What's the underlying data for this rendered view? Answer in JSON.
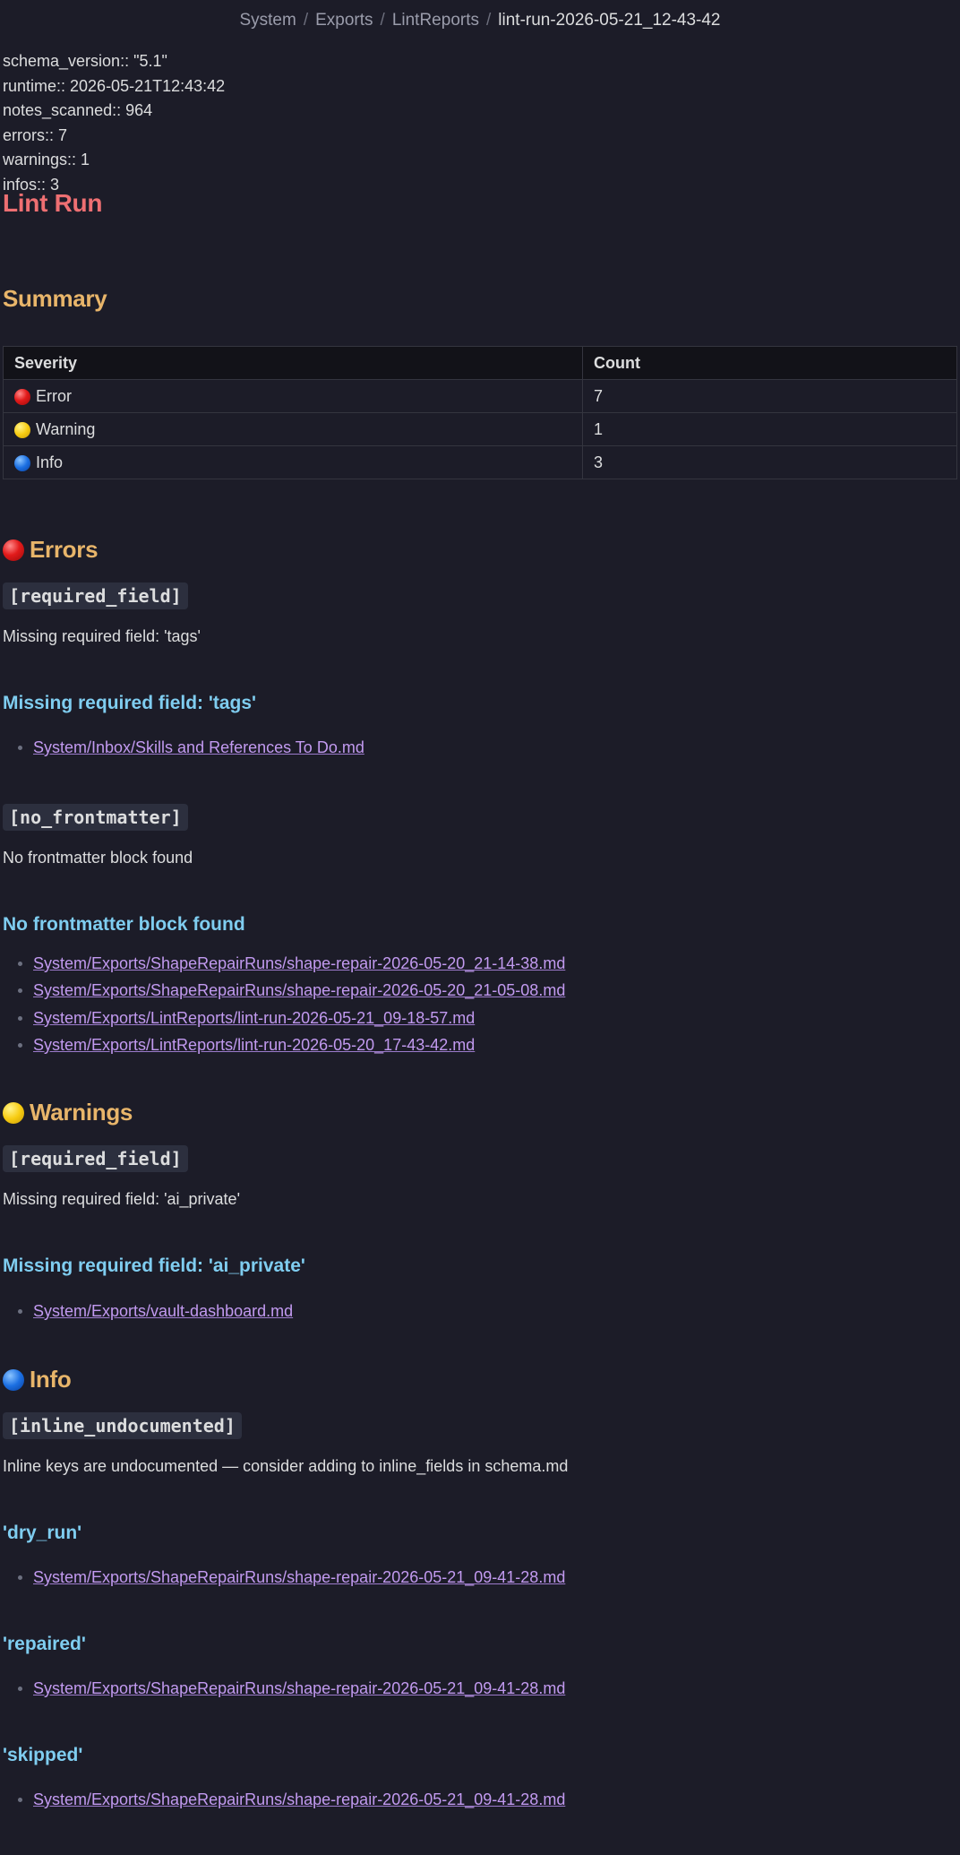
{
  "breadcrumb": {
    "items": [
      "System",
      "Exports",
      "LintReports"
    ],
    "current": "lint-run-2026-05-21_12-43-42",
    "separator": "/"
  },
  "properties": [
    "schema_version:: \"5.1\"",
    "runtime:: 2026-05-21T12:43:42",
    "notes_scanned:: 964",
    "errors:: 7",
    "warnings:: 1",
    "infos:: 3"
  ],
  "title": "Lint Run",
  "summary": {
    "heading": "Summary",
    "columns": [
      "Severity",
      "Count"
    ],
    "rows": [
      {
        "label": "Error",
        "count": "7",
        "icon": "red-circle-icon"
      },
      {
        "label": "Warning",
        "count": "1",
        "icon": "yellow-circle-icon"
      },
      {
        "label": "Info",
        "count": "3",
        "icon": "blue-circle-icon"
      }
    ]
  },
  "errors": {
    "heading": "Errors",
    "groups": [
      {
        "code": "[required_field]",
        "description": "Missing required field: 'tags'",
        "subheading": "Missing required field: 'tags'",
        "links": [
          "System/Inbox/Skills and References To Do.md"
        ]
      },
      {
        "code": "[no_frontmatter]",
        "description": "No frontmatter block found",
        "subheading": "No frontmatter block found",
        "links": [
          "System/Exports/ShapeRepairRuns/shape-repair-2026-05-20_21-14-38.md",
          "System/Exports/ShapeRepairRuns/shape-repair-2026-05-20_21-05-08.md",
          "System/Exports/LintReports/lint-run-2026-05-21_09-18-57.md",
          "System/Exports/LintReports/lint-run-2026-05-20_17-43-42.md"
        ]
      }
    ]
  },
  "warnings": {
    "heading": "Warnings",
    "groups": [
      {
        "code": "[required_field]",
        "description": "Missing required field: 'ai_private'",
        "subheading": "Missing required field: 'ai_private'",
        "links": [
          "System/Exports/vault-dashboard.md"
        ]
      }
    ]
  },
  "info": {
    "heading": "Info",
    "code": "[inline_undocumented]",
    "description": "Inline keys are undocumented — consider adding to inline_fields in schema.md",
    "groups": [
      {
        "subheading": "'dry_run'",
        "links": [
          "System/Exports/ShapeRepairRuns/shape-repair-2026-05-21_09-41-28.md"
        ]
      },
      {
        "subheading": "'repaired'",
        "links": [
          "System/Exports/ShapeRepairRuns/shape-repair-2026-05-21_09-41-28.md"
        ]
      },
      {
        "subheading": "'skipped'",
        "links": [
          "System/Exports/ShapeRepairRuns/shape-repair-2026-05-21_09-41-28.md"
        ]
      }
    ]
  },
  "colors": {
    "background": "#1c1c28",
    "title": "#ee6f72",
    "h2": "#e8b56a",
    "h3": "#7fcdf0",
    "link": "#c29af0"
  }
}
